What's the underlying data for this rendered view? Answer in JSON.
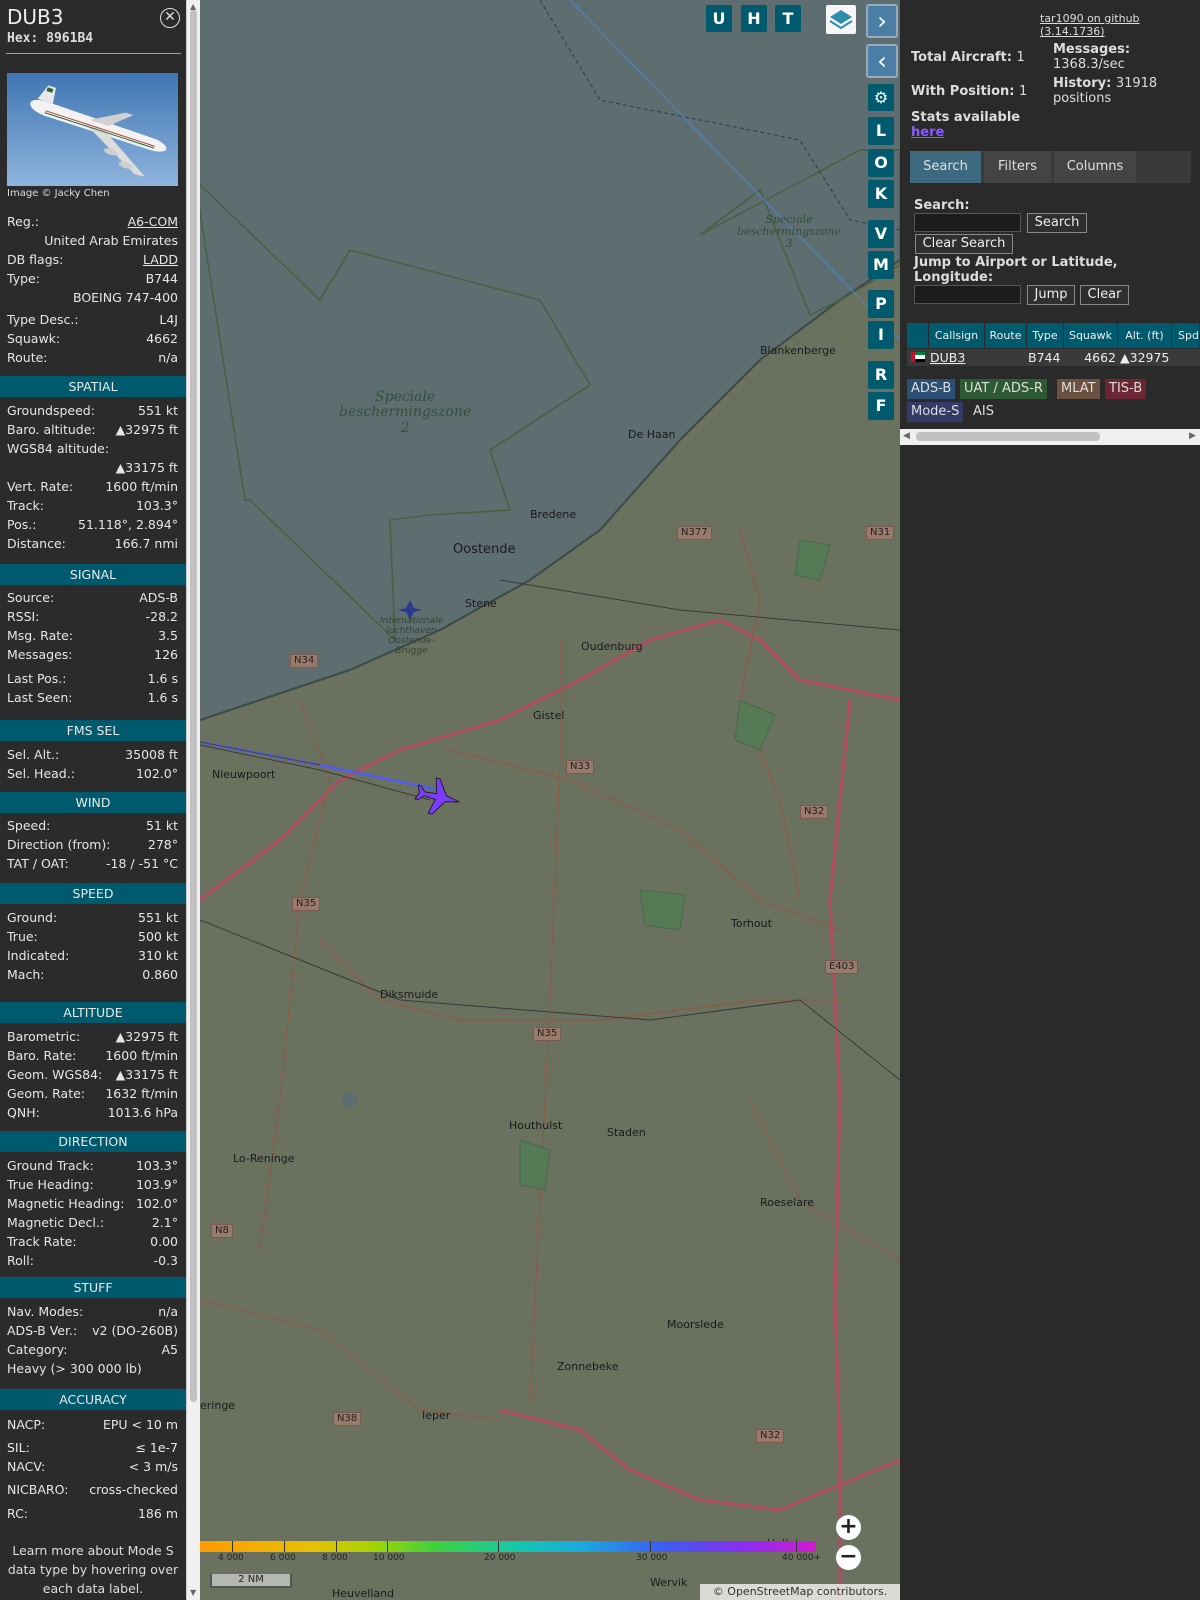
{
  "aircraft": {
    "callsign": "DUB3",
    "hex": "Hex: 8961B4",
    "photo_credit": "Image © Jacky Chen",
    "details": [
      {
        "label": "Reg.:",
        "value": "A6-COM",
        "link": true
      },
      {
        "label": "",
        "value": "United Arab Emirates"
      },
      {
        "label": "DB flags:",
        "value": "LADD",
        "link": true
      },
      {
        "label": "Type:",
        "value": "B744"
      },
      {
        "label": "",
        "value": "BOEING 747-400"
      },
      {
        "label": "Type Desc.:",
        "value": "L4J"
      },
      {
        "label": "Squawk:",
        "value": "4662"
      },
      {
        "label": "Route:",
        "value": "n/a"
      }
    ]
  },
  "sections": [
    {
      "title": "SPATIAL",
      "rows": [
        {
          "label": "Groundspeed:",
          "value": "551 kt"
        },
        {
          "label": "Baro. altitude:",
          "value": "▲32975 ft"
        },
        {
          "label": "WGS84 altitude:",
          "value": ""
        },
        {
          "label": "",
          "value": "▲33175 ft"
        },
        {
          "label": "Vert. Rate:",
          "value": "1600 ft/min"
        },
        {
          "label": "Track:",
          "value": "103.3°"
        },
        {
          "label": "Pos.:",
          "value": "51.118°, 2.894°"
        },
        {
          "label": "Distance:",
          "value": "166.7 nmi"
        }
      ]
    },
    {
      "title": "SIGNAL",
      "rows": [
        {
          "label": "Source:",
          "value": "ADS-B"
        },
        {
          "label": "RSSI:",
          "value": "-28.2"
        },
        {
          "label": "Msg. Rate:",
          "value": "3.5"
        },
        {
          "label": "Messages:",
          "value": "126"
        },
        {
          "label": "Last Pos.:",
          "value": "1.6 s"
        },
        {
          "label": "Last Seen:",
          "value": "1.6 s"
        }
      ]
    },
    {
      "title": "FMS SEL",
      "rows": [
        {
          "label": "Sel. Alt.:",
          "value": "35008 ft"
        },
        {
          "label": "Sel. Head.:",
          "value": "102.0°"
        }
      ]
    },
    {
      "title": "WIND",
      "rows": [
        {
          "label": "Speed:",
          "value": "51 kt"
        },
        {
          "label": "Direction (from):",
          "value": "278°"
        },
        {
          "label": "TAT / OAT:",
          "value": "-18 / -51 °C"
        }
      ]
    },
    {
      "title": "SPEED",
      "rows": [
        {
          "label": "Ground:",
          "value": "551 kt"
        },
        {
          "label": "True:",
          "value": "500 kt"
        },
        {
          "label": "Indicated:",
          "value": "310 kt"
        },
        {
          "label": "Mach:",
          "value": "0.860"
        }
      ]
    },
    {
      "title": "ALTITUDE",
      "rows": [
        {
          "label": "Barometric:",
          "value": "▲32975 ft"
        },
        {
          "label": "Baro. Rate:",
          "value": "1600 ft/min"
        },
        {
          "label": "Geom. WGS84:",
          "value": "▲33175 ft"
        },
        {
          "label": "Geom. Rate:",
          "value": "1632 ft/min"
        },
        {
          "label": "QNH:",
          "value": "1013.6 hPa"
        }
      ]
    },
    {
      "title": "DIRECTION",
      "rows": [
        {
          "label": "Ground Track:",
          "value": "103.3°"
        },
        {
          "label": "True Heading:",
          "value": "103.9°"
        },
        {
          "label": "Magnetic Heading:",
          "value": "102.0°"
        },
        {
          "label": "Magnetic Decl.:",
          "value": "2.1°"
        },
        {
          "label": "Track Rate:",
          "value": "0.00"
        },
        {
          "label": "Roll:",
          "value": "-0.3"
        }
      ]
    },
    {
      "title": "STUFF",
      "rows": [
        {
          "label": "Nav. Modes:",
          "value": "n/a"
        },
        {
          "label": "ADS-B Ver.:",
          "value": "v2 (DO-260B)"
        },
        {
          "label": "Category:",
          "value": "A5"
        },
        {
          "label": "Heavy (> 300 000 lb)",
          "value": ""
        }
      ]
    },
    {
      "title": "ACCURACY",
      "rows": [
        {
          "label": "NACP:",
          "value": "EPU < 10 m"
        },
        {
          "label": "SIL:",
          "value": "≤ 1e-7"
        },
        {
          "label": "NACV:",
          "value": "< 3 m/s"
        },
        {
          "label": "NICBARO:",
          "value": "cross-checked"
        },
        {
          "label": "RC:",
          "value": "186 m"
        }
      ]
    }
  ],
  "learn_more": [
    "Learn more about Mode S",
    "data type by hovering over",
    "each data label."
  ],
  "map": {
    "top_buttons": [
      "U",
      "H",
      "T"
    ],
    "side_buttons": [
      "L",
      "O",
      "K",
      "V",
      "M",
      "P",
      "I",
      "R",
      "F"
    ],
    "zone2": [
      "Speciale",
      "beschermingszone",
      "2"
    ],
    "zone3": [
      "Speciale",
      "beschermingszone",
      "3"
    ],
    "airport": [
      "Internationale",
      "luchthaven",
      "Oostende-",
      "Brugge"
    ],
    "places": [
      "Blankenberge",
      "De Haan",
      "Bredene",
      "Oostende",
      "Stene",
      "Oudenburg",
      "Gistel",
      "Nieuwpoort",
      "Torhout",
      "Diksmuide",
      "Houthulst",
      "Staden",
      "Lo-Reninge",
      "Roeselare",
      "Moorslede",
      "Zonnebeke",
      "Ieper",
      "eringe",
      "Halluin",
      "Wervik",
      "Heuvelland"
    ],
    "roads": [
      "N377",
      "N31",
      "N34",
      "N33",
      "N32",
      "N35",
      "E403",
      "N35",
      "N8",
      "N38",
      "N32"
    ],
    "colorbar_ticks": [
      "4 000",
      "6 000",
      "8 000",
      "10 000",
      "20 000",
      "30 000",
      "40 000+"
    ],
    "scale": "2 NM",
    "attribution": "© OpenStreetMap contributors."
  },
  "panel": {
    "github": "tar1090 on github (3.14.1736)",
    "total_aircraft_label": "Total Aircraft:",
    "total_aircraft": "1",
    "with_position_label": "With Position:",
    "with_position": "1",
    "messages_label": "Messages:",
    "messages": "1368.3/sec",
    "history_label": "History:",
    "history": "31918",
    "history_unit": "positions",
    "stats_text": "Stats available",
    "stats_link": "here",
    "tabs": [
      "Search",
      "Filters",
      "Columns"
    ],
    "search_label": "Search:",
    "search_button": "Search",
    "clear_search_button": "Clear Search",
    "jump_label": "Jump to Airport or Latitude, Longitude:",
    "jump_button": "Jump",
    "clear_button": "Clear",
    "table_headers": [
      "Callsign",
      "Route",
      "Type",
      "Squawk",
      "Alt. (ft)",
      "Spd"
    ],
    "table_row": {
      "callsign": "DUB3",
      "route": "",
      "type": "B744",
      "squawk": "4662",
      "alt": "▲32975"
    },
    "badges": [
      "ADS-B",
      "UAT / ADS-R",
      "MLAT",
      "TIS-B",
      "Mode-S",
      "AIS"
    ]
  },
  "colors": {
    "section_header": "#005a6e",
    "aircraft": "#7b3cff",
    "track": "#4f5cf0",
    "sea": "#5d6d70",
    "land": "#6b715f"
  }
}
